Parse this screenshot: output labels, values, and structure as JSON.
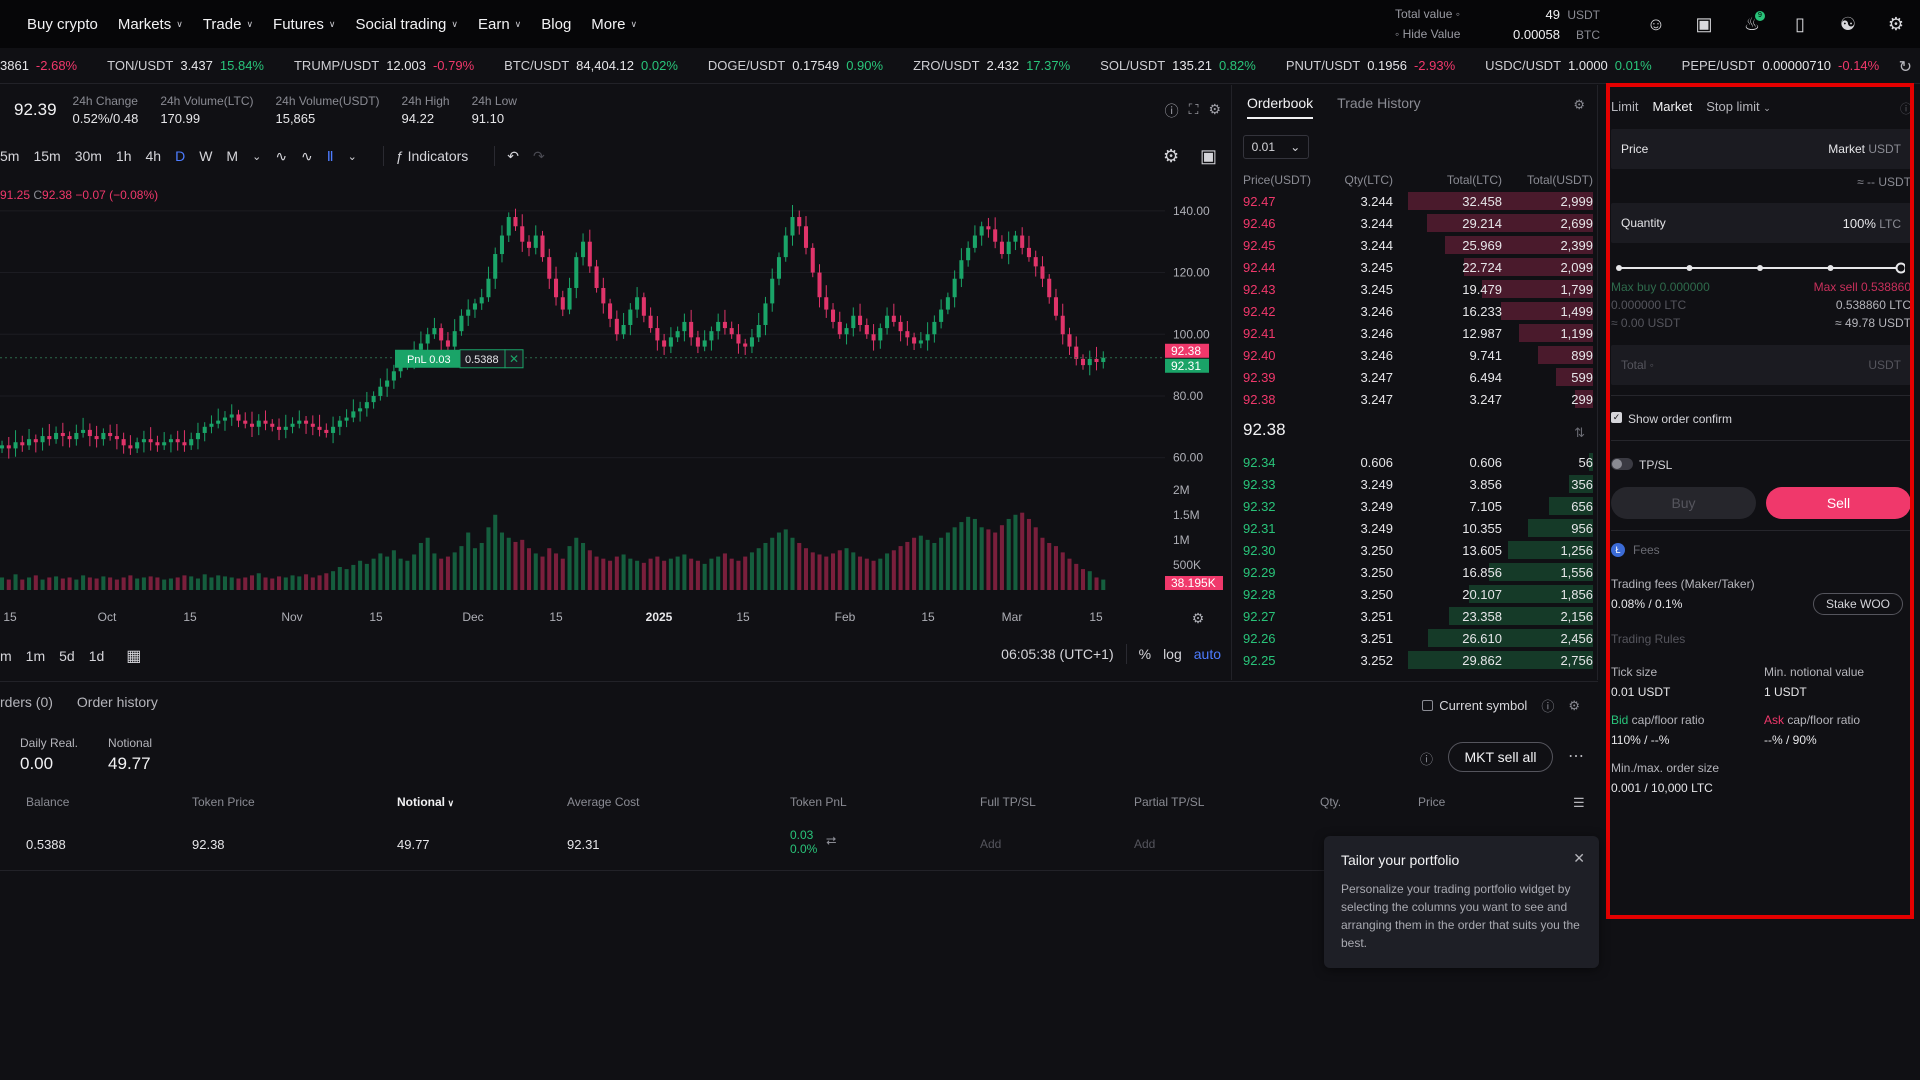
{
  "nav": {
    "items": [
      {
        "label": "Buy crypto",
        "chev": false
      },
      {
        "label": "Markets",
        "chev": true
      },
      {
        "label": "Trade",
        "chev": true
      },
      {
        "label": "Futures",
        "chev": true
      },
      {
        "label": "Social trading",
        "chev": true
      },
      {
        "label": "Earn",
        "chev": true
      },
      {
        "label": "Blog",
        "chev": false
      },
      {
        "label": "More",
        "chev": true
      }
    ],
    "total_value_label": "Total value ◦",
    "total_value": "49",
    "total_value_unit": "USDT",
    "hide_value_label": "◦ Hide Value",
    "btc_value": "0.00058",
    "btc_unit": "BTC",
    "notif_count": "9"
  },
  "ticker": [
    {
      "sym": "",
      "price": "3861",
      "chg": "-2.68%",
      "dir": "dn"
    },
    {
      "sym": "TON/USDT",
      "price": "3.437",
      "chg": "15.84%",
      "dir": "up"
    },
    {
      "sym": "TRUMP/USDT",
      "price": "12.003",
      "chg": "-0.79%",
      "dir": "dn"
    },
    {
      "sym": "BTC/USDT",
      "price": "84,404.12",
      "chg": "0.02%",
      "dir": "up"
    },
    {
      "sym": "DOGE/USDT",
      "price": "0.17549",
      "chg": "0.90%",
      "dir": "up"
    },
    {
      "sym": "ZRO/USDT",
      "price": "2.432",
      "chg": "17.37%",
      "dir": "up"
    },
    {
      "sym": "SOL/USDT",
      "price": "135.21",
      "chg": "0.82%",
      "dir": "up"
    },
    {
      "sym": "PNUT/USDT",
      "price": "0.1956",
      "chg": "-2.93%",
      "dir": "dn"
    },
    {
      "sym": "USDC/USDT",
      "price": "1.0000",
      "chg": "0.01%",
      "dir": "up"
    },
    {
      "sym": "PEPE/USDT",
      "price": "0.00000710",
      "chg": "-0.14%",
      "dir": "dn"
    }
  ],
  "stats": {
    "last": "92.39",
    "items": [
      {
        "label": "24h Change",
        "value": "0.52%/0.48",
        "cls": "up"
      },
      {
        "label": "24h Volume(LTC)",
        "value": "170.99",
        "cls": ""
      },
      {
        "label": "24h Volume(USDT)",
        "value": "15,865",
        "cls": ""
      },
      {
        "label": "24h High",
        "value": "94.22",
        "cls": ""
      },
      {
        "label": "24h Low",
        "value": "91.10",
        "cls": ""
      }
    ]
  },
  "toolbar": {
    "intervals": [
      "5m",
      "15m",
      "30m",
      "1h",
      "4h",
      "D",
      "W",
      "M"
    ],
    "active": "D",
    "indicators": "Indicators"
  },
  "ohlc": {
    "l": "91.25",
    "c_label": "C",
    "c": "92.38",
    "chg": "−0.07 (−0.08%)"
  },
  "chart_data": {
    "type": "candlestick",
    "price_ticks": [
      "140.00",
      "120.00",
      "100.00",
      "80.00",
      "60.00"
    ],
    "price_tick_values": [
      140,
      120,
      100,
      80,
      60
    ],
    "volume_ticks": [
      "2M",
      "1.5M",
      "1M",
      "500K"
    ],
    "volume_tick_values": [
      2000000,
      1500000,
      1000000,
      500000
    ],
    "time_labels": [
      "15",
      "Oct",
      "15",
      "Nov",
      "15",
      "Dec",
      "15",
      "2025",
      "15",
      "Feb",
      "15",
      "Mar",
      "15"
    ],
    "last_price_tag": "92.38",
    "avg_cost_tag": "92.31",
    "volume_tag": "38.195K",
    "position_label": "PnL 0.03",
    "position_qty": "0.5388",
    "closes": [
      64,
      63,
      65,
      64,
      66,
      65,
      67,
      66,
      68,
      67,
      66,
      68,
      69,
      67,
      66,
      68,
      67,
      66,
      64,
      63,
      65,
      66,
      65,
      64,
      65,
      66,
      65,
      64,
      66,
      68,
      70,
      71,
      72,
      73,
      74,
      72,
      71,
      70,
      72,
      71,
      70,
      69,
      70,
      71,
      72,
      71,
      70,
      69,
      68,
      70,
      72,
      73,
      75,
      76,
      78,
      80,
      83,
      85,
      88,
      90,
      92,
      95,
      97,
      100,
      102,
      98,
      96,
      101,
      106,
      108,
      110,
      112,
      118,
      126,
      132,
      138,
      135,
      130,
      128,
      132,
      125,
      118,
      112,
      108,
      115,
      125,
      130,
      122,
      115,
      110,
      105,
      100,
      103,
      108,
      112,
      106,
      102,
      98,
      96,
      99,
      101,
      104,
      99,
      96,
      98,
      101,
      104,
      102,
      100,
      97,
      96,
      99,
      103,
      110,
      118,
      125,
      132,
      138,
      135,
      128,
      120,
      112,
      108,
      104,
      100,
      102,
      106,
      103,
      100,
      98,
      102,
      106,
      104,
      101,
      99,
      97,
      98,
      100,
      104,
      108,
      112,
      118,
      124,
      128,
      132,
      135,
      134,
      130,
      126,
      130,
      132,
      128,
      125,
      122,
      118,
      112,
      106,
      100,
      96,
      92,
      90,
      92,
      91,
      92.38
    ],
    "volume_level": "low-high",
    "vols": [
      0.12,
      0.1,
      0.15,
      0.1,
      0.12,
      0.14,
      0.1,
      0.12,
      0.13,
      0.11,
      0.12,
      0.1,
      0.14,
      0.12,
      0.11,
      0.13,
      0.12,
      0.1,
      0.12,
      0.14,
      0.11,
      0.12,
      0.13,
      0.12,
      0.1,
      0.11,
      0.12,
      0.14,
      0.13,
      0.11,
      0.15,
      0.12,
      0.14,
      0.13,
      0.12,
      0.11,
      0.12,
      0.14,
      0.16,
      0.12,
      0.11,
      0.13,
      0.12,
      0.14,
      0.13,
      0.15,
      0.12,
      0.14,
      0.16,
      0.18,
      0.22,
      0.2,
      0.24,
      0.28,
      0.25,
      0.3,
      0.35,
      0.32,
      0.38,
      0.3,
      0.28,
      0.34,
      0.45,
      0.5,
      0.35,
      0.3,
      0.32,
      0.36,
      0.42,
      0.55,
      0.4,
      0.45,
      0.6,
      0.72,
      0.55,
      0.5,
      0.46,
      0.48,
      0.4,
      0.35,
      0.32,
      0.4,
      0.35,
      0.3,
      0.42,
      0.5,
      0.45,
      0.38,
      0.32,
      0.3,
      0.28,
      0.32,
      0.34,
      0.3,
      0.28,
      0.26,
      0.3,
      0.32,
      0.28,
      0.3,
      0.32,
      0.34,
      0.3,
      0.28,
      0.25,
      0.3,
      0.32,
      0.35,
      0.3,
      0.28,
      0.32,
      0.36,
      0.4,
      0.45,
      0.5,
      0.55,
      0.58,
      0.5,
      0.45,
      0.4,
      0.36,
      0.34,
      0.32,
      0.35,
      0.38,
      0.4,
      0.36,
      0.32,
      0.3,
      0.28,
      0.3,
      0.35,
      0.38,
      0.42,
      0.46,
      0.5,
      0.52,
      0.48,
      0.45,
      0.5,
      0.55,
      0.6,
      0.65,
      0.7,
      0.68,
      0.6,
      0.58,
      0.55,
      0.62,
      0.68,
      0.72,
      0.74,
      0.68,
      0.6,
      0.5,
      0.45,
      0.42,
      0.36,
      0.3,
      0.25,
      0.2,
      0.18,
      0.12
    ]
  },
  "bottombar": {
    "ranges": [
      "1m",
      "5d",
      "1d"
    ],
    "prefix": "m",
    "time": "06:05:38 (UTC+1)",
    "pct": "%",
    "log": "log",
    "auto": "auto"
  },
  "orderbook": {
    "tab_book": "Orderbook",
    "tab_history": "Trade History",
    "precision": "0.01",
    "headers": [
      "Price(USDT)",
      "Qty(LTC)",
      "Total(LTC)",
      "Total(USDT)"
    ],
    "asks": [
      [
        "92.47",
        "3.244",
        "32.458",
        "2,999",
        1.0
      ],
      [
        "92.46",
        "3.244",
        "29.214",
        "2,699",
        0.9
      ],
      [
        "92.45",
        "3.244",
        "25.969",
        "2,399",
        0.8
      ],
      [
        "92.44",
        "3.245",
        "22.724",
        "2,099",
        0.7
      ],
      [
        "92.43",
        "3.245",
        "19.479",
        "1,799",
        0.6
      ],
      [
        "92.42",
        "3.246",
        "16.233",
        "1,499",
        0.5
      ],
      [
        "92.41",
        "3.246",
        "12.987",
        "1,199",
        0.4
      ],
      [
        "92.40",
        "3.246",
        "9.741",
        "899",
        0.3
      ],
      [
        "92.39",
        "3.247",
        "6.494",
        "599",
        0.2
      ],
      [
        "92.38",
        "3.247",
        "3.247",
        "299",
        0.1
      ]
    ],
    "mid": "92.38",
    "bids": [
      [
        "92.34",
        "0.606",
        "0.606",
        "56",
        0.02
      ],
      [
        "92.33",
        "3.249",
        "3.856",
        "356",
        0.13
      ],
      [
        "92.32",
        "3.249",
        "7.105",
        "656",
        0.24
      ],
      [
        "92.31",
        "3.249",
        "10.355",
        "956",
        0.35
      ],
      [
        "92.30",
        "3.250",
        "13.605",
        "1,256",
        0.46
      ],
      [
        "92.29",
        "3.250",
        "16.856",
        "1,556",
        0.56
      ],
      [
        "92.28",
        "3.250",
        "20.107",
        "1,856",
        0.67
      ],
      [
        "92.27",
        "3.251",
        "23.358",
        "2,156",
        0.78
      ],
      [
        "92.26",
        "3.251",
        "26.610",
        "2,456",
        0.89
      ],
      [
        "92.25",
        "3.252",
        "29.862",
        "2,756",
        1.0
      ]
    ]
  },
  "form": {
    "tabs": [
      "Limit",
      "Market",
      "Stop limit"
    ],
    "active": "Market",
    "price_label": "Price",
    "price_value": "Market",
    "price_unit": "USDT",
    "approx": "≈ -- USDT",
    "qty_label": "Quantity",
    "qty_value": "100%",
    "qty_unit": "LTC",
    "slider_value": 1.0,
    "max_buy": "Max buy 0.000000",
    "max_sell": "Max sell 0.538860",
    "buy_ltc": "0.000000 LTC",
    "sell_ltc": "0.538860 LTC",
    "buy_usdt": "≈ 0.00 USDT",
    "sell_usdt": "≈ 49.78 USDT",
    "total_label": "Total ◦",
    "total_unit": "USDT",
    "show_confirm": "Show order confirm",
    "tpsl": "TP/SL",
    "buy": "Buy",
    "sell": "Sell",
    "fees": "Fees",
    "trading_fees_label": "Trading fees (Maker/Taker)",
    "trading_fees": "0.08% / 0.1%",
    "stake": "Stake WOO",
    "rules": "Trading Rules",
    "tick_label": "Tick size",
    "tick": "0.01 USDT",
    "notional_label": "Min. notional value",
    "notional": "1 USDT",
    "bid_label_a": "Bid",
    "bid_label_b": " cap/floor ratio",
    "bid": "110% / --%",
    "ask_label_a": "Ask",
    "ask_label_b": " cap/floor ratio",
    "ask": "--% / 90%",
    "size_label": "Min./max. order size",
    "size": "0.001 / 10,000 LTC"
  },
  "positions": {
    "tabs": [
      "rders (0)",
      "Order history"
    ],
    "current_symbol": "Current symbol",
    "daily_label": "Daily Real.",
    "daily": "0.00",
    "notional_label": "Notional",
    "notional": "49.77",
    "mkt_sell": "MKT sell all",
    "headers": [
      "Balance",
      "Token Price",
      "Notional",
      "Average Cost",
      "Token PnL",
      "Full TP/SL",
      "Partial TP/SL",
      "Qty.",
      "Price"
    ],
    "row": {
      "balance": "0.5388",
      "token_price": "92.38",
      "notional": "49.77",
      "avg": "92.31",
      "pnl": "0.03",
      "pnl_pct": "0.0%",
      "full": "Add",
      "partial": "Add"
    }
  },
  "tooltip": {
    "title": "Tailor your portfolio",
    "text": "Personalize your trading portfolio widget by selecting the columns you want to see and arranging them in the order that suits you the best."
  },
  "colors": {
    "up": "#29c47a",
    "down": "#f0386b",
    "accent": "#4d7cff",
    "highlight": "#e40000"
  }
}
